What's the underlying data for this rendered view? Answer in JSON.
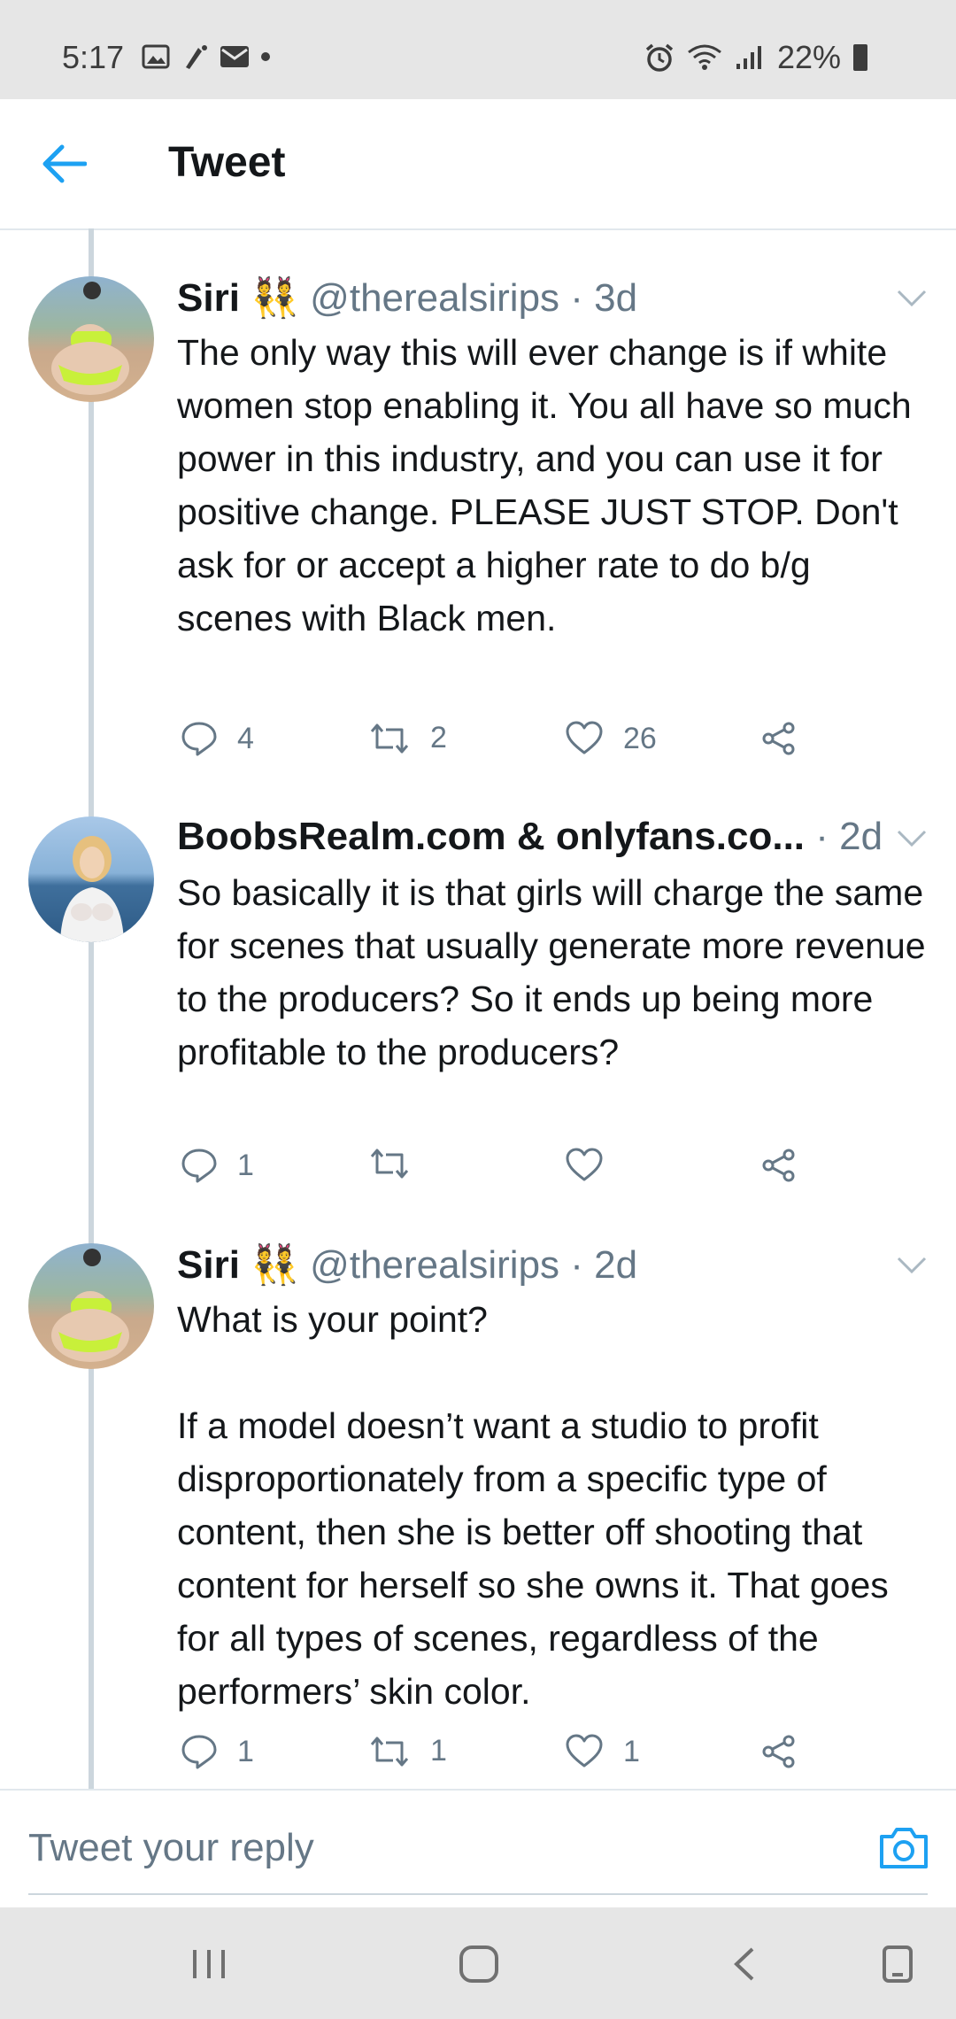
{
  "status_bar": {
    "time": "5:17",
    "battery": "22%"
  },
  "header": {
    "title": "Tweet"
  },
  "tweets": [
    {
      "name": "Siri 👯",
      "handle": "@therealsirips",
      "time": "3d",
      "text": "The only way this will ever change is if white women stop enabling it. You all have so much power in this industry, and you can use it for positive change. PLEASE JUST STOP. Don't ask for or accept a higher rate to do b/g scenes with Black men.",
      "replies": "4",
      "retweets": "2",
      "likes": "26"
    },
    {
      "name": "BoobsRealm.com & onlyfans.co...",
      "handle": "",
      "time": "2d",
      "text": "So basically it is that girls will charge the same for scenes that usually generate more revenue to the producers? So it ends up being more profitable to the producers?",
      "replies": "1",
      "retweets": "",
      "likes": ""
    },
    {
      "name": "Siri 👯",
      "handle": "@therealsirips",
      "time": "2d",
      "text": "What is your point?\n\nIf a model doesn’t want a studio to profit disproportionately from a specific type of content, then she is better off shooting that content for herself so she owns it. That goes for all types of scenes, regardless of the performers’ skin color.",
      "replies": "1",
      "retweets": "1",
      "likes": "1"
    }
  ],
  "reply": {
    "placeholder": "Tweet your reply"
  },
  "colors": {
    "accent": "#1da1f2",
    "text": "#14171a",
    "secondary": "#657786",
    "divider": "#e1e8ed"
  },
  "icons": [
    "back-arrow-icon",
    "chevron-down-icon",
    "reply-icon",
    "retweet-icon",
    "like-icon",
    "share-icon",
    "camera-icon",
    "recent-apps-icon",
    "home-icon",
    "back-nav-icon",
    "screenshot-icon"
  ]
}
